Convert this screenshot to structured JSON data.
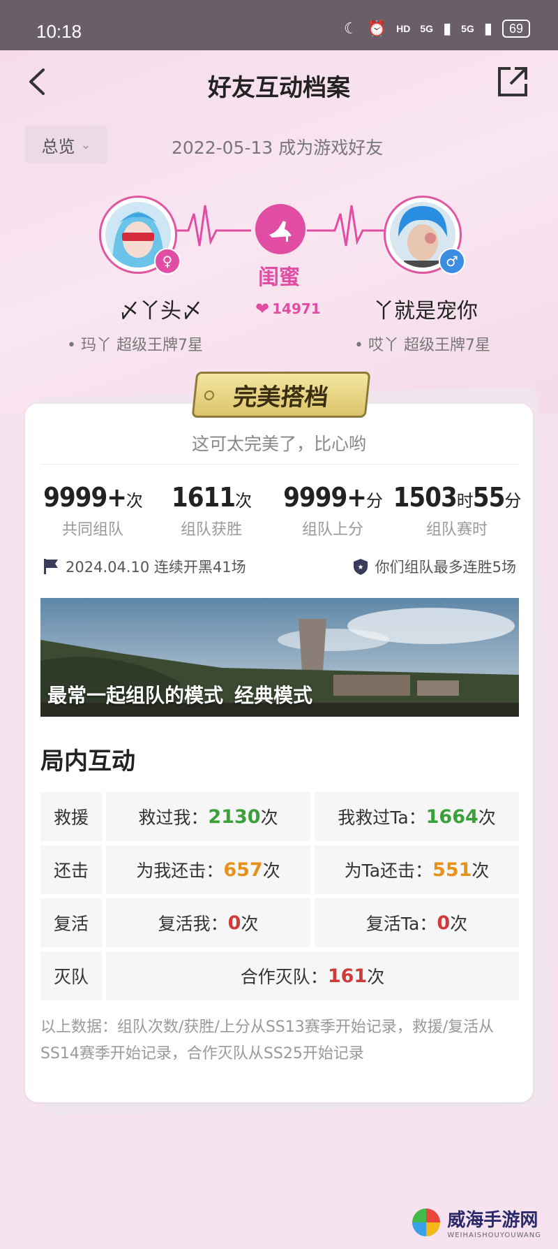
{
  "status_bar": {
    "time": "10:18",
    "hd": "HD",
    "net1": "5G",
    "net2": "5G",
    "battery": "69"
  },
  "header": {
    "title": "好友互动档案",
    "back_icon": "chevron-left-icon",
    "share_icon": "share-icon"
  },
  "filter": {
    "selected": "总览"
  },
  "friend_since": "2022-05-13 成为游戏好友",
  "left_player": {
    "name": "〆丫头〆",
    "rank": "• 玛丫 超级王牌7星",
    "gender": "♀",
    "gender_color": "#e24da4"
  },
  "right_player": {
    "name": "丫就是宠你",
    "rank": "• 哎丫 超级王牌7星",
    "gender": "♂",
    "gender_color": "#3a8de0"
  },
  "relation": {
    "label": "闺蜜",
    "intimacy": "14971"
  },
  "card": {
    "tag": "完美搭档",
    "tagline": "这可太完美了，比心哟",
    "stats": [
      {
        "value": "9999+",
        "unit": "次",
        "label": "共同组队"
      },
      {
        "value": "1611",
        "unit": "次",
        "label": "组队获胜"
      },
      {
        "value": "9999+",
        "unit": "分",
        "label": "组队上分"
      },
      {
        "value": "1503",
        "unit": "时",
        "value2": "55",
        "unit2": "分",
        "label": "组队赛时"
      }
    ],
    "streak_left": "2024.04.10 连续开黑41场",
    "streak_right": "你们组队最多连胜5场",
    "banner_title": "最常一起组队的模式",
    "banner_mode": "经典模式"
  },
  "interaction": {
    "title": "局内互动",
    "rows": [
      {
        "label": "救援",
        "a_text": "救过我：",
        "a_num": "2130",
        "a_unit": "次",
        "b_text": "我救过Ta：",
        "b_num": "1664",
        "b_unit": "次"
      },
      {
        "label": "还击",
        "a_text": "为我还击：",
        "a_num": "657",
        "a_unit": "次",
        "b_text": "为Ta还击：",
        "b_num": "551",
        "b_unit": "次"
      },
      {
        "label": "复活",
        "a_text": "复活我：",
        "a_num": "0",
        "a_unit": "次",
        "b_text": "复活Ta：",
        "b_num": "0",
        "b_unit": "次"
      }
    ],
    "wipe_label": "灭队",
    "wipe_text": "合作灭队：",
    "wipe_num": "161",
    "wipe_unit": "次"
  },
  "footnote": "以上数据：组队次数/获胜/上分从SS13赛季开始记录，救援/复活从SS14赛季开始记录，合作灭队从SS25开始记录",
  "watermark": {
    "name": "威海手游网",
    "sub": "WEIHAISHOUYOUWANG"
  }
}
